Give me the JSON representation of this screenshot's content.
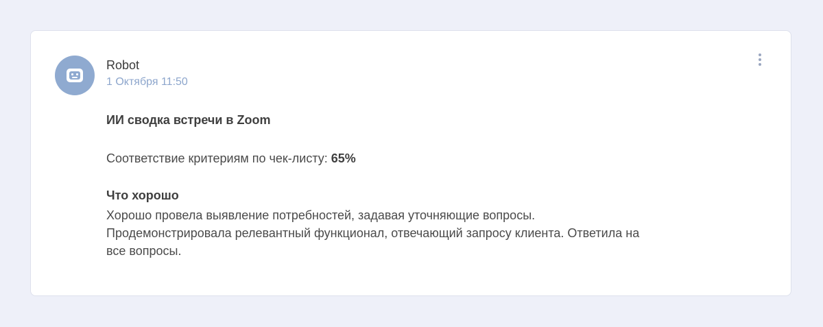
{
  "message": {
    "author": "Robot",
    "date": "1 Октября 11:50",
    "avatar_icon": "robot-icon",
    "menu_icon": "more-vertical-icon",
    "title": "ИИ сводка встречи в Zoom",
    "compliance_label": "Соответствие критериям по чек-листу: ",
    "compliance_value": "65%",
    "good_heading": "Что хорошо",
    "good_lines": [
      "Хорошо провела выявление потребностей, задавая уточняющие вопросы.",
      "Продемонстрировала релевантный функционал, отвечающий запросу клиента. Ответила на",
      "все вопросы."
    ]
  },
  "colors": {
    "background": "#eef0f9",
    "card": "#ffffff",
    "avatar": "#8faad0",
    "date": "#8da6cc",
    "text": "#4a4a4a"
  }
}
